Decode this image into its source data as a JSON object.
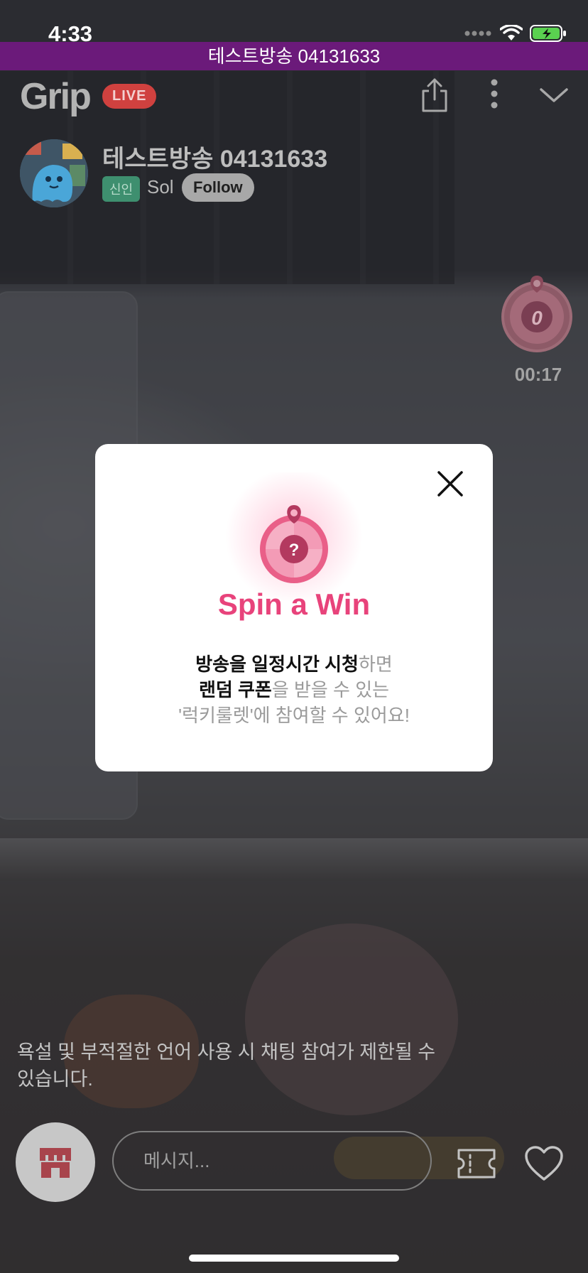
{
  "status_bar": {
    "time": "4:33"
  },
  "banner": {
    "text": "테스트방송 04131633"
  },
  "header": {
    "logo": "Grip",
    "live_badge": "LIVE"
  },
  "stream": {
    "title": "테스트방송 04131633",
    "tag": "신인",
    "host": "Sol",
    "follow_label": "Follow"
  },
  "roulette": {
    "count": "0",
    "timer": "00:17"
  },
  "modal": {
    "wheel_symbol": "?",
    "title": "Spin a Win",
    "line1_bold": "방송을 일정시간 시청",
    "line1_rest": "하면",
    "line2_bold": "랜덤 쿠폰",
    "line2_rest": "을 받을 수 있는",
    "line3": "'럭키룰렛'에 참여할 수 있어요!"
  },
  "chat": {
    "notice": "욕설 및 부적절한 언어 사용 시 채팅 참여가 제한될 수 있습니다.",
    "input_placeholder": "메시지..."
  },
  "colors": {
    "accent": "#e8437b",
    "banner": "#6b1a7a",
    "live": "#d0413f",
    "new_tag": "#3e8f6f"
  },
  "icons": [
    "wifi-icon",
    "battery-icon",
    "share-icon",
    "more-icon",
    "chevron-down-icon",
    "close-icon",
    "roulette-icon",
    "shop-icon",
    "coupon-icon",
    "heart-icon"
  ]
}
